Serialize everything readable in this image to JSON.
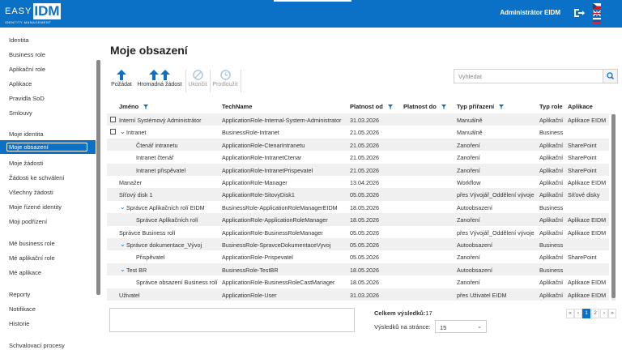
{
  "header": {
    "logo_text": "EASY",
    "logo_mark": "IDM",
    "logo_sub": "IDENTITY MANAGEMENT",
    "user_name": "Administrátor EIDM",
    "brand_color": "#0b71c6"
  },
  "sidebar": {
    "items": [
      "Identita",
      "Business role",
      "Aplikační role",
      "Aplikace",
      "Pravidla SoD",
      "Smlouvy",
      "Moje identita",
      "Moje obsazení",
      "Moje žádosti",
      "Žádosti ke schválení",
      "Všechny žádosti",
      "Moje řízené identity",
      "Moji podřízení",
      "Mé business role",
      "Mé aplikační role",
      "Mé aplikace",
      "Reporty",
      "Notifikace",
      "Historie",
      "Schvalovací procesy"
    ],
    "active_index": 7
  },
  "page": {
    "title": "Moje obsazení"
  },
  "toolbar": {
    "request": "Požádat",
    "bulk_request": "Hromadná žádost",
    "end": "Ukončit",
    "extend": "Prodloužit"
  },
  "search": {
    "placeholder": "Vyhledat"
  },
  "table": {
    "columns": {
      "name": "Jméno",
      "techname": "TechName",
      "valid_from": "Platnost od",
      "valid_to": "Platnost do",
      "assignment_type": "Typ přiřazení",
      "role_type": "Typ role",
      "application": "Aplikace"
    },
    "rows": [
      {
        "name": "Interní Systémový Administrátor",
        "techname": "ApplicationRole-Internal-System-Administrator",
        "from": "31.03.2026",
        "to": "",
        "assign": "Manuálně",
        "type": "Aplikační",
        "app": "Aplikace EIDM"
      },
      {
        "name": "Intranet",
        "techname": "BusinessRole-Intranet",
        "from": "21.05.2026",
        "to": "",
        "assign": "Manuálně",
        "type": "Business",
        "app": ""
      },
      {
        "name": "Čtenář intranetu",
        "techname": "ApplicationRole-CtenarIntranetu",
        "from": "21.05.2026",
        "to": "",
        "assign": "Zanoření",
        "type": "Aplikační",
        "app": "SharePoint"
      },
      {
        "name": "Intranet čtenář",
        "techname": "ApplicationRole-IntranetCtenar",
        "from": "21.05.2026",
        "to": "",
        "assign": "Zanoření",
        "type": "Aplikační",
        "app": "SharePoint"
      },
      {
        "name": "Intranet přispěvatel",
        "techname": "ApplicationRole-IntranetPrispevatel",
        "from": "21.05.2026",
        "to": "",
        "assign": "Zanoření",
        "type": "Aplikační",
        "app": "SharePoint"
      },
      {
        "name": "Manažer",
        "techname": "ApplicationRole-Manager",
        "from": "13.04.2026",
        "to": "",
        "assign": "Workflow",
        "type": "Aplikační",
        "app": "Aplikace EIDM"
      },
      {
        "name": "Síťový disk 1",
        "techname": "ApplicationRole-SitovyDisk1",
        "from": "05.05.2026",
        "to": "",
        "assign": "přes Vývojář_Oddělení vývoje",
        "type": "Aplikační",
        "app": "Síťové disky"
      },
      {
        "name": "Správce Aplikačních rolí EIDM",
        "techname": "BusinessRole-ApplicationRoleManagerEIDM",
        "from": "18.05.2026",
        "to": "",
        "assign": "Autoobsazení",
        "type": "Business",
        "app": ""
      },
      {
        "name": "Správce Aplikačních rolí",
        "techname": "ApplicationRole-ApplicationRoleManager",
        "from": "18.05.2026",
        "to": "",
        "assign": "Zanoření",
        "type": "Aplikační",
        "app": "Aplikace EIDM"
      },
      {
        "name": "Správce Business rolí",
        "techname": "ApplicationRole-BusinessRoleManager",
        "from": "05.05.2026",
        "to": "",
        "assign": "přes Vývojář_Oddělení vývoje",
        "type": "Aplikační",
        "app": "Aplikace EIDM"
      },
      {
        "name": "Správce dokumentace_Vývoj",
        "techname": "BusinessRole-SpravceDokumentaceVyvoj",
        "from": "05.05.2026",
        "to": "",
        "assign": "Autoobsazení",
        "type": "Business",
        "app": ""
      },
      {
        "name": "Přispěvatel",
        "techname": "ApplicationRole-Prispevatel",
        "from": "05.05.2026",
        "to": "",
        "assign": "Zanoření",
        "type": "Aplikační",
        "app": "SharePoint"
      },
      {
        "name": "Test BR",
        "techname": "BusinessRole-TestBR",
        "from": "18.05.2026",
        "to": "",
        "assign": "Autoobsazení",
        "type": "Business",
        "app": ""
      },
      {
        "name": "Správce obsazení Business rolí",
        "techname": "ApplicationRole-BusinessRoleCastManager",
        "from": "18.05.2026",
        "to": "",
        "assign": "Zanoření",
        "type": "Aplikační",
        "app": "Aplikace EIDM"
      },
      {
        "name": "Uživatel",
        "techname": "ApplicationRole-User",
        "from": "31.03.2026",
        "to": "",
        "assign": "přes Uživatel EIDM",
        "type": "Aplikační",
        "app": "Aplikace EIDM"
      }
    ]
  },
  "footer": {
    "total_label": "Celkem výsledků:",
    "total_value": "17",
    "per_page_label": "Výsledků na stránce:",
    "per_page_value": "15",
    "pager": [
      "«",
      "‹",
      "1",
      "2",
      "›",
      "»"
    ]
  }
}
